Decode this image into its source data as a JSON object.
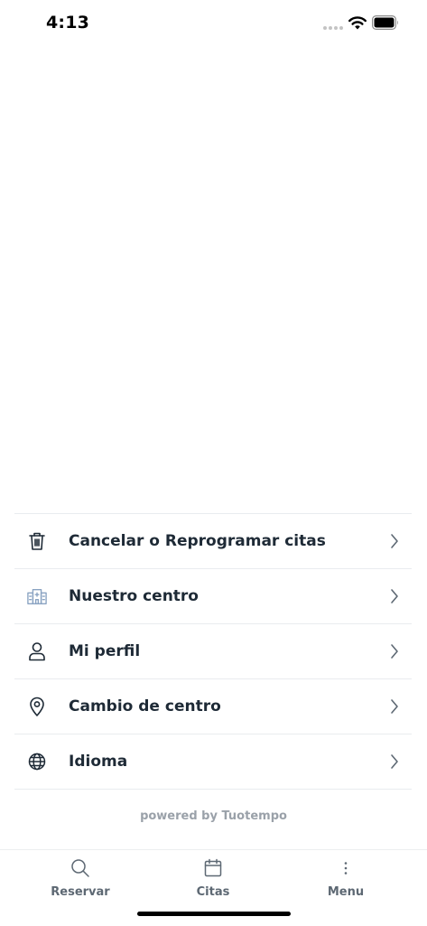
{
  "status_bar": {
    "time": "4:13"
  },
  "menu": {
    "items": [
      {
        "label": "Cancelar o Reprogramar citas",
        "icon": "trash-icon"
      },
      {
        "label": "Nuestro centro",
        "icon": "building-icon"
      },
      {
        "label": "Mi perfil",
        "icon": "user-icon"
      },
      {
        "label": "Cambio de centro",
        "icon": "location-pin-icon"
      },
      {
        "label": "Idioma",
        "icon": "globe-icon"
      }
    ]
  },
  "footer": {
    "powered_by": "powered by Tuotempo"
  },
  "tab_bar": {
    "tabs": [
      {
        "label": "Reservar",
        "icon": "search-icon"
      },
      {
        "label": "Citas",
        "icon": "calendar-icon"
      },
      {
        "label": "Menu",
        "icon": "more-vertical-icon"
      }
    ]
  },
  "colors": {
    "text": "#1e2a36",
    "muted": "#9aa1a9",
    "tab_label": "#5d6873",
    "divider": "#e9ecef"
  }
}
